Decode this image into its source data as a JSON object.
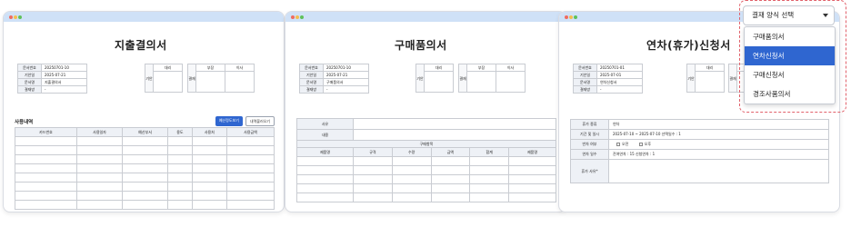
{
  "windows": [
    {
      "title": "지출결의서",
      "meta": [
        [
          "문서번호",
          "20250701-10"
        ],
        [
          "기안일",
          "2025-07-21"
        ],
        [
          "문서명",
          "지출결의서"
        ],
        [
          "결재방",
          "-"
        ]
      ],
      "gian_label": "기안",
      "gyeoljae_label": "결재",
      "approval_heads": [
        "대리",
        "부장",
        "이사"
      ],
      "section_label": "사용내역",
      "btn_primary": "예산정도보기",
      "btn_secondary": "내역불러오기",
      "columns": [
        "카드번호",
        "사용일자",
        "예산부서",
        "용도",
        "사용처",
        "사용금액"
      ]
    },
    {
      "title": "구매품의서",
      "meta": [
        [
          "문서번호",
          "20250701-10"
        ],
        [
          "기안일",
          "2025-07-21"
        ],
        [
          "문서명",
          "구매품의서"
        ],
        [
          "결재방",
          "-"
        ]
      ],
      "gian_label": "기안",
      "gyeoljae_label": "결재",
      "approval_heads": [
        "대리",
        "부장",
        "이사"
      ],
      "reason_label": "사유",
      "content_label": "내용",
      "group_header": "구매항목",
      "columns": [
        "제품명",
        "규격",
        "수량",
        "금액",
        "합계",
        "제품명"
      ]
    },
    {
      "title": "연차(휴가)신청서",
      "meta": [
        [
          "문서번호",
          "20250701-01"
        ],
        [
          "기안일",
          "2025-07-01"
        ],
        [
          "문서명",
          "연차신청서"
        ],
        [
          "결재방",
          "-"
        ]
      ],
      "gian_label": "기안",
      "gyeoljae_label": "결재",
      "approval_heads": [
        "대리",
        "부"
      ],
      "form": {
        "type_label": "휴가 종류",
        "type_value": "연차",
        "period_label": "기간 및 일시",
        "period_value": "2025-07-10 ~ 2025-07-10   선택일수 : 1",
        "half_label": "반차 여부",
        "half_am": "오전",
        "half_pm": "오후",
        "days_label": "연차 일수",
        "days_value": "잔여연차 : 15   신청연차 : 1",
        "reason_label": "휴가 사유*"
      }
    }
  ],
  "dropdown": {
    "selected_label": "결재 양식 선택",
    "options": [
      "구매품의서",
      "연차신청서",
      "구매신청서",
      "경조사품의서"
    ],
    "highlighted_index": 1
  }
}
